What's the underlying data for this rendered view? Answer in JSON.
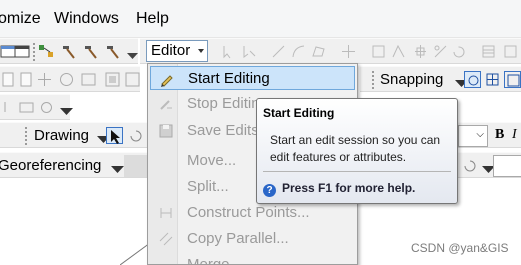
{
  "menubar": {
    "items": [
      "omize",
      "Windows",
      "Help"
    ]
  },
  "toolbar": {
    "editor_label": "Editor",
    "snapping_label": "Snapping",
    "drawing_label": "Drawing",
    "georef_label": "Georeferencing",
    "bold_label": "B",
    "italic_label": "I"
  },
  "editor_menu": {
    "items": [
      {
        "label": "Start Editing",
        "state": "highlighted"
      },
      {
        "label": "Stop Editing",
        "state": "disabled"
      },
      {
        "label": "Save Edits",
        "state": "disabled"
      },
      {
        "label": "Move...",
        "state": "disabled"
      },
      {
        "label": "Split...",
        "state": "disabled"
      },
      {
        "label": "Construct Points...",
        "state": "disabled"
      },
      {
        "label": "Copy Parallel...",
        "state": "disabled"
      },
      {
        "label": "Merge...",
        "state": "disabled"
      }
    ]
  },
  "tooltip": {
    "title": "Start Editing",
    "body": "Start an edit session so you can edit features or attributes.",
    "help": "Press F1 for more help."
  },
  "watermark": "CSDN @yan&GIS",
  "colors": {
    "highlight": "#cce4fa",
    "accent": "#2a66c8"
  }
}
